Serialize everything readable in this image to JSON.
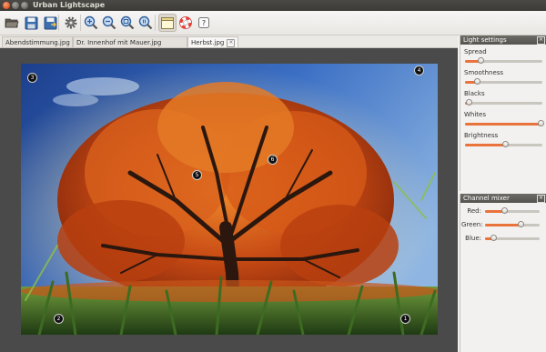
{
  "window": {
    "title": "Urban Lightscape"
  },
  "toolbar": {
    "buttons": [
      {
        "name": "open-button",
        "icon": "folder-open-icon"
      },
      {
        "name": "save-button",
        "icon": "floppy-icon"
      },
      {
        "name": "save-as-button",
        "icon": "floppy-arrow-icon"
      },
      {
        "name": "settings-button",
        "icon": "gear-icon"
      },
      {
        "name": "zoom-in-button",
        "icon": "zoom-in-icon"
      },
      {
        "name": "zoom-out-button",
        "icon": "zoom-out-icon"
      },
      {
        "name": "zoom-fit-button",
        "icon": "zoom-fit-icon"
      },
      {
        "name": "zoom-original-button",
        "icon": "zoom-original-icon"
      },
      {
        "name": "toggle-panels-button",
        "icon": "panel-icon"
      },
      {
        "name": "help-button",
        "icon": "lifebuoy-icon"
      },
      {
        "name": "about-button",
        "icon": "info-icon"
      }
    ]
  },
  "tabs": [
    {
      "label": "Abendstimmung.jpg",
      "active": false
    },
    {
      "label": "Dr. Innenhof mit Mauer.jpg",
      "active": false
    },
    {
      "label": "Herbst.jpg",
      "active": true
    }
  ],
  "markers": [
    "1",
    "2",
    "3",
    "4",
    "5",
    "6"
  ],
  "light_settings": {
    "title": "Light settings",
    "sliders": [
      {
        "label": "Spread",
        "value": 0.2
      },
      {
        "label": "Smoothness",
        "value": 0.15
      },
      {
        "label": "Blacks",
        "value": 0.05
      },
      {
        "label": "Whites",
        "value": 0.98
      },
      {
        "label": "Brightness",
        "value": 0.52
      }
    ]
  },
  "channel_mixer": {
    "title": "Channel mixer",
    "sliders": [
      {
        "label": "Red:",
        "value": 0.35
      },
      {
        "label": "Green:",
        "value": 0.65
      },
      {
        "label": "Blue:",
        "value": 0.15
      }
    ]
  },
  "colors": {
    "accent": "#e9733a",
    "titlebar": "#3c3b37",
    "panel_header": "#5f5d58"
  }
}
